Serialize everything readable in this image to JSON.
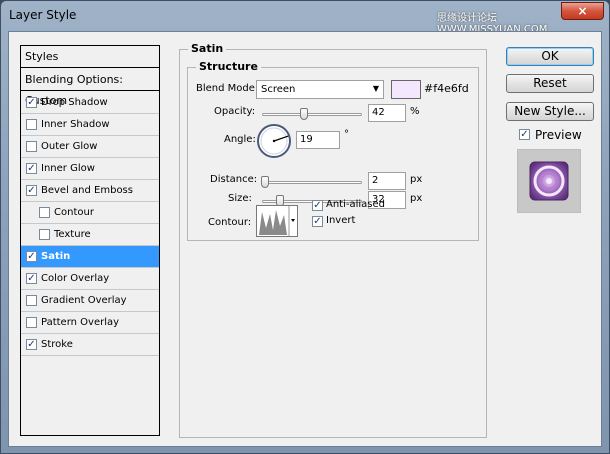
{
  "window": {
    "title": "Layer Style",
    "watermark": "思缘设计论坛 WWW.MISSYUAN.COM",
    "close_glyph": "×"
  },
  "styles_list": {
    "header": "Styles",
    "blending_options": "Blending Options: Custom",
    "items": [
      {
        "label": "Drop Shadow",
        "checked": true
      },
      {
        "label": "Inner Shadow",
        "checked": false
      },
      {
        "label": "Outer Glow",
        "checked": false
      },
      {
        "label": "Inner Glow",
        "checked": true
      },
      {
        "label": "Bevel and Emboss",
        "checked": true
      },
      {
        "label": "Contour",
        "checked": false
      },
      {
        "label": "Texture",
        "checked": false
      },
      {
        "label": "Satin",
        "checked": true
      },
      {
        "label": "Color Overlay",
        "checked": true
      },
      {
        "label": "Gradient Overlay",
        "checked": false
      },
      {
        "label": "Pattern Overlay",
        "checked": false
      },
      {
        "label": "Stroke",
        "checked": true
      }
    ],
    "selected": "Satin"
  },
  "satin": {
    "group_title": "Satin",
    "structure_title": "Structure",
    "blend_mode_label": "Blend Mode:",
    "blend_mode_value": "Screen",
    "color_hex_label": "#f4e6fd",
    "color": "#f4e6fd",
    "opacity_label": "Opacity:",
    "opacity_value": "42",
    "opacity_unit": "%",
    "opacity_fraction": 0.42,
    "angle_label": "Angle:",
    "angle_value": "19",
    "angle_unit": "°",
    "distance_label": "Distance:",
    "distance_value": "2",
    "distance_unit": "px",
    "size_label": "Size:",
    "size_value": "32",
    "size_unit": "px",
    "contour_label": "Contour:",
    "anti_aliased_label": "Anti-aliased",
    "anti_aliased_checked": true,
    "invert_label": "Invert",
    "invert_checked": true
  },
  "buttons": {
    "ok": "OK",
    "reset": "Reset",
    "new_style": "New Style...",
    "preview_label": "Preview",
    "preview_checked": true
  },
  "colors": {
    "selection": "#3399ff",
    "preview_purple": "#9a62b8"
  }
}
